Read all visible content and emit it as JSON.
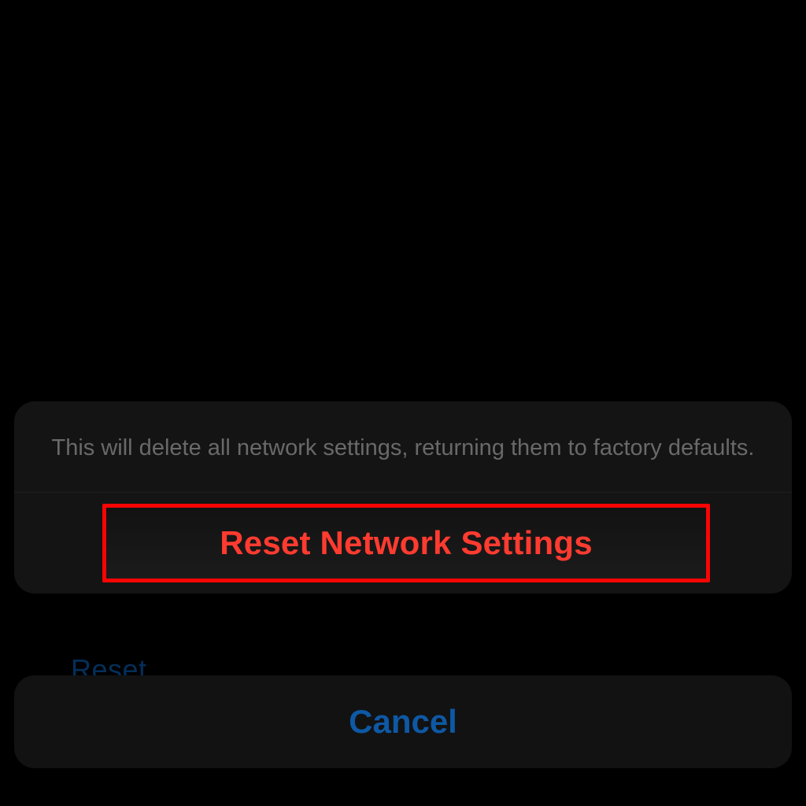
{
  "dialog": {
    "message": "This will delete all network settings, returning them to factory defaults.",
    "primary_action_label": "Reset Network Settings",
    "cancel_label": "Cancel"
  },
  "background": {
    "partial_text": "Reset"
  },
  "colors": {
    "destructive": "#ff3b30",
    "highlight_border": "#fb0404",
    "cancel_text": "#0e58a4",
    "sheet_bg": "#141414"
  }
}
